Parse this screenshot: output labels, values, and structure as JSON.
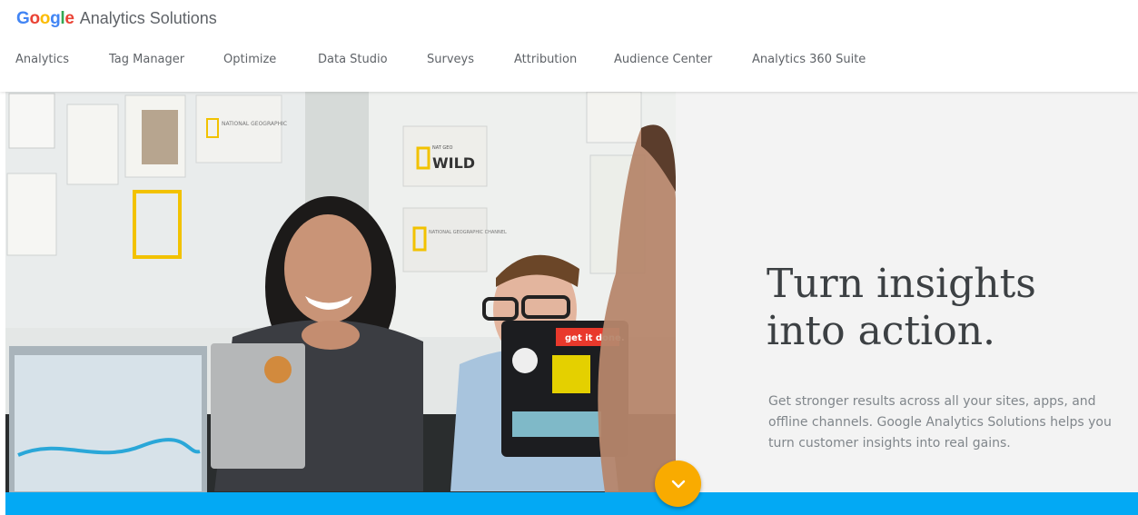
{
  "header": {
    "logo": {
      "letters": [
        {
          "char": "G",
          "color": "#4285F4"
        },
        {
          "char": "o",
          "color": "#EA4335"
        },
        {
          "char": "o",
          "color": "#FBBC05"
        },
        {
          "char": "g",
          "color": "#4285F4"
        },
        {
          "char": "l",
          "color": "#34A853"
        },
        {
          "char": "e",
          "color": "#EA4335"
        }
      ],
      "product": "Analytics Solutions"
    },
    "nav": [
      {
        "label": "Analytics"
      },
      {
        "label": "Tag Manager"
      },
      {
        "label": "Optimize"
      },
      {
        "label": "Data Studio"
      },
      {
        "label": "Surveys"
      },
      {
        "label": "Attribution"
      },
      {
        "label": "Audience Center"
      },
      {
        "label": "Analytics 360 Suite"
      }
    ]
  },
  "hero": {
    "headline_line1": "Turn insights",
    "headline_line2": "into action.",
    "subtext": "Get stronger results across all your sites, apps, and offline channels. Google Analytics Solutions helps you turn customer insights into real gains.",
    "photo_signs": {
      "natgeo": "NATIONAL GEOGRAPHIC",
      "wild_top": "NAT GEO",
      "wild": "WILD",
      "channel": "NATIONAL GEOGRAPHIC CHANNEL",
      "sticker": "get it done."
    },
    "scroll_icon": "chevron-down-icon"
  },
  "colors": {
    "accent_blue": "#03A9F4",
    "scroll_button": "#F9AB00",
    "headline": "#3C4043",
    "subtext": "#80868B"
  }
}
